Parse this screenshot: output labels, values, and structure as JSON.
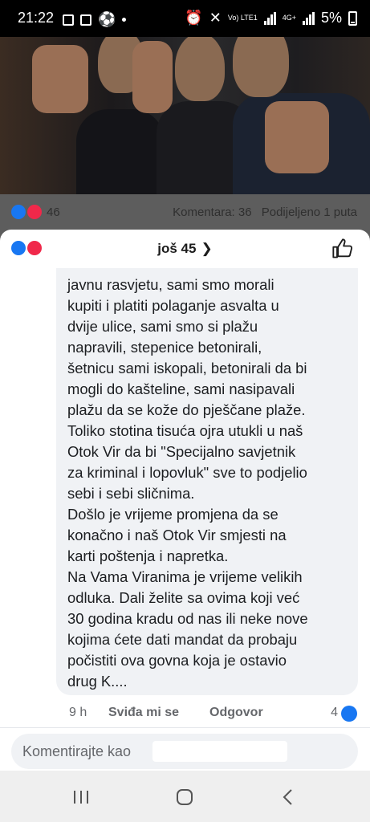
{
  "status_bar": {
    "time": "21:22",
    "network_label": "Vo) LTE1",
    "network_type": "4G+",
    "battery": "5%"
  },
  "post": {
    "reaction_count": "46",
    "comments": "Komentara: 36",
    "shares": "Podijeljeno 1 puta"
  },
  "comments_sheet": {
    "header_title": "još 45",
    "comment_text": "javnu rasvjetu, sami smo morali\nkupiti i platiti polaganje asvalta u\ndvije ulice, sami smo si plažu\nnapravili, stepenice betonirali,\nšetnicu sami iskopali, betonirali da bi\nmogli do kašteline, sami nasipavali\nplažu da se kože do pješčane plaže.\nToliko stotina tisuća ojra utukli u naš\nOtok Vir da bi \"Specijalno savjetnik\nza kriminal i lopovluk\" sve to podjelio\nsebi i sebi sličnima.\nDošlo je vrijeme promjena da se\nkonačno i naš Otok Vir smjesti na\nkarti poštenja i napretka.\nNa Vama Viranima je vrijeme velikih\nodluka. Dali želite sa ovima koji već\n30 godina kradu od nas ili neke nove\nkojima ćete dati mandat da probaju\npočistiti ova govna koja je ostavio\ndrug K....",
    "time_ago": "9 h",
    "like_label": "Sviđa mi se",
    "reply_label": "Odgovor",
    "like_count": "4"
  },
  "comment_input": {
    "placeholder": "Komentirajte kao"
  },
  "colors": {
    "like_blue": "#1877f2",
    "love_red": "#f0284a",
    "bubble_bg": "#f0f2f5"
  }
}
